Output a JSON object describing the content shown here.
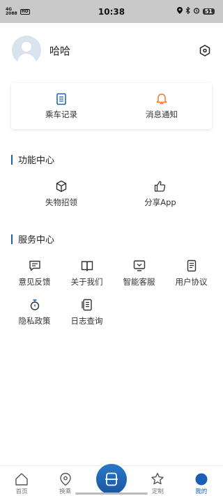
{
  "status_bar": {
    "network_top": "4G",
    "network_bottom": "2088",
    "hd_badge": "HD",
    "time": "10:38",
    "battery": "51"
  },
  "profile": {
    "username": "哈哈"
  },
  "quick_card": {
    "items": [
      {
        "label": "乘车记录",
        "icon": "document-icon",
        "color": "#1a5fb4"
      },
      {
        "label": "消息通知",
        "icon": "bell-icon",
        "color": "#f07a2e"
      }
    ]
  },
  "function_center": {
    "title": "功能中心",
    "items": [
      {
        "label": "失物招领",
        "icon": "cube-icon"
      },
      {
        "label": "分享App",
        "icon": "thumbs-up-icon"
      }
    ]
  },
  "service_center": {
    "title": "服务中心",
    "items": [
      {
        "label": "意见反馈",
        "icon": "comment-icon"
      },
      {
        "label": "关于我们",
        "icon": "book-icon"
      },
      {
        "label": "智能客服",
        "icon": "tv-icon"
      },
      {
        "label": "用户协议",
        "icon": "agreement-icon"
      },
      {
        "label": "隐私政策",
        "icon": "privacy-icon"
      },
      {
        "label": "日志查询",
        "icon": "log-icon"
      }
    ]
  },
  "tabbar": {
    "tabs": [
      {
        "label": "首页",
        "icon": "home-icon",
        "active": false
      },
      {
        "label": "换乘",
        "icon": "location-icon",
        "active": false
      },
      {
        "label": "",
        "icon": "scan-icon",
        "active": false
      },
      {
        "label": "定制",
        "icon": "star-icon",
        "active": false
      },
      {
        "label": "我的",
        "icon": "profile-icon",
        "active": true
      }
    ]
  },
  "colors": {
    "accent": "#1a5fb4",
    "bell": "#f07a2e"
  }
}
